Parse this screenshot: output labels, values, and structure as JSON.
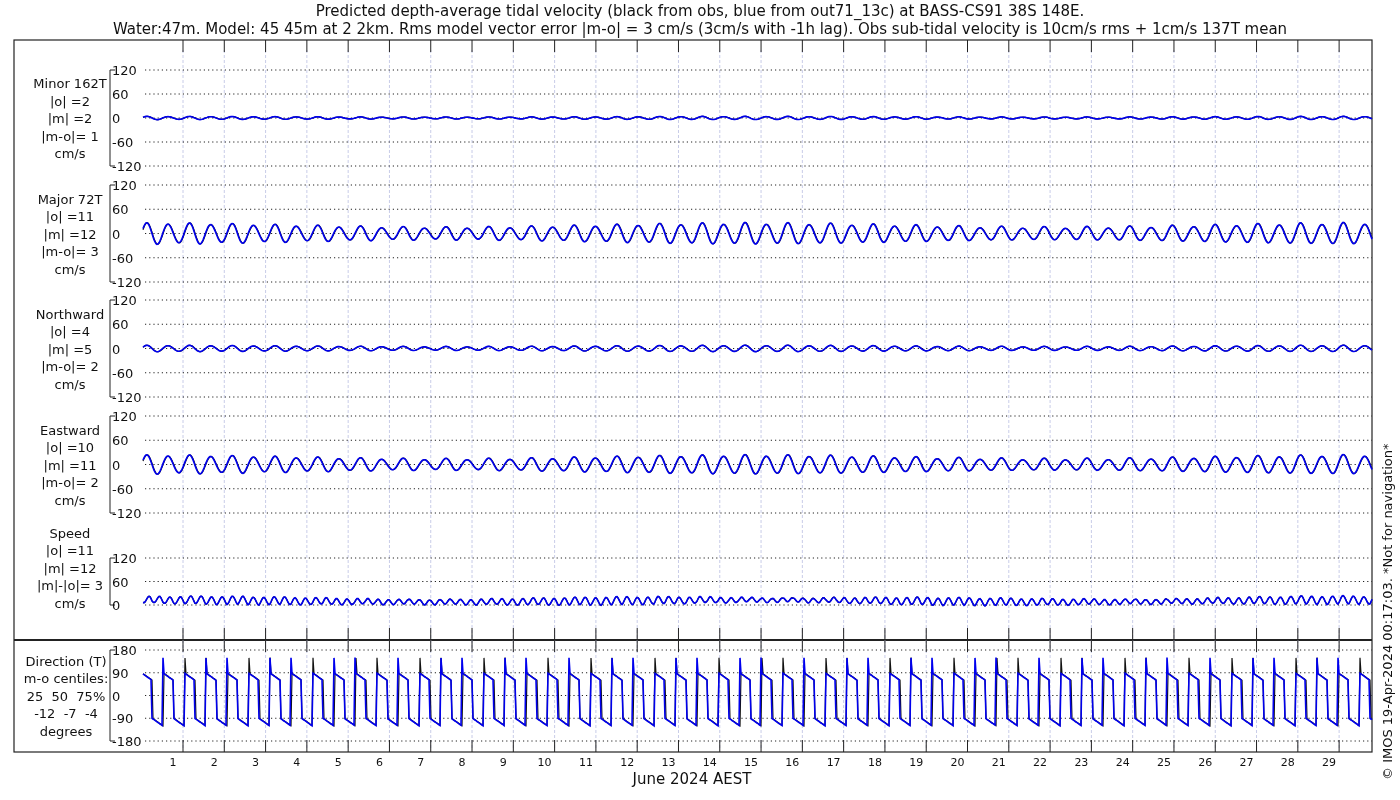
{
  "title": [
    "Predicted depth-average tidal velocity (black from obs, blue from out71_13c) at BASS-CS91 38S 148E.",
    "Water:47m. Model: 45 45m at 2 2km. Rms model vector error |m-o| = 3 cm/s (3cm/s with -1h lag). Obs sub-tidal velocity is 10cm/s rms + 1cm/s 137T mean"
  ],
  "panels": [
    {
      "kind": "velocity",
      "label": [
        "Minor 162T",
        "|o| =2",
        "|m| =2",
        "|m-o|= 1",
        "cm/s"
      ],
      "yticks": [
        "120",
        "60",
        "0",
        "-60",
        "-120"
      ]
    },
    {
      "kind": "velocity",
      "label": [
        "Major 72T",
        "|o| =11",
        "|m| =12",
        "|m-o|= 3",
        "cm/s"
      ],
      "yticks": [
        "120",
        "60",
        "0",
        "-60",
        "-120"
      ]
    },
    {
      "kind": "velocity",
      "label": [
        "Northward",
        "|o| =4",
        "|m| =5",
        "|m-o|= 2",
        "cm/s"
      ],
      "yticks": [
        "120",
        "60",
        "0",
        "-60",
        "-120"
      ]
    },
    {
      "kind": "velocity",
      "label": [
        "Eastward",
        "|o| =10",
        "|m| =11",
        "|m-o|= 2",
        "cm/s"
      ],
      "yticks": [
        "120",
        "60",
        "0",
        "-60",
        "-120"
      ]
    },
    {
      "kind": "speed",
      "label": [
        "Speed",
        "|o| =11",
        "|m| =12",
        "|m|-|o|= 3",
        "cm/s"
      ],
      "yticks": [
        "120",
        "60",
        "0"
      ]
    },
    {
      "kind": "direction",
      "label": [
        "Direction (T)",
        "m-o centiles:",
        "25  50  75%",
        "-12  -7  -4",
        "degrees"
      ],
      "yticks": [
        "180",
        "90",
        "0",
        "-90",
        "-180"
      ]
    }
  ],
  "xticks": [
    "1",
    "2",
    "3",
    "4",
    "5",
    "6",
    "7",
    "8",
    "9",
    "10",
    "11",
    "12",
    "13",
    "14",
    "15",
    "16",
    "17",
    "18",
    "19",
    "20",
    "21",
    "22",
    "23",
    "24",
    "25",
    "26",
    "27",
    "28",
    "29"
  ],
  "xlabel": "June 2024 AEST",
  "side_note": "© IMOS 19-Apr-2024 00:17:03. *Not for navigation*"
}
